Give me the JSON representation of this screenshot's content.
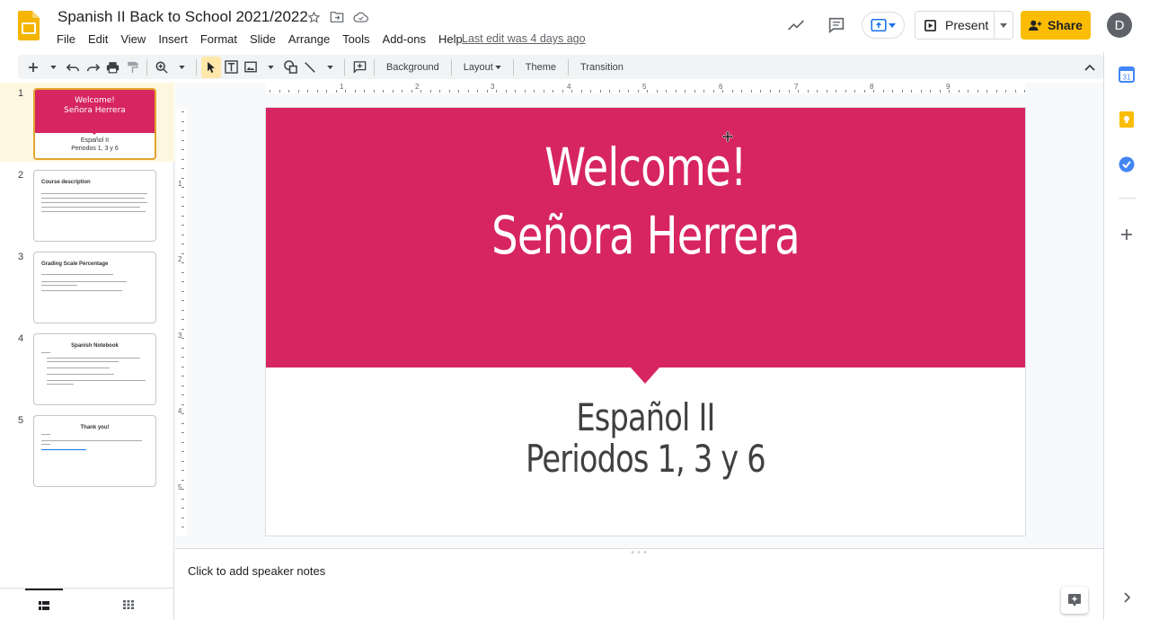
{
  "header": {
    "title": "Spanish II Back to School 2021/2022",
    "last_edit": "Last edit was 4 days ago",
    "menu": [
      "File",
      "Edit",
      "View",
      "Insert",
      "Format",
      "Slide",
      "Arrange",
      "Tools",
      "Add-ons",
      "Help"
    ],
    "present_label": "Present",
    "share_label": "Share",
    "avatar_initial": "D"
  },
  "toolbar": {
    "background_label": "Background",
    "layout_label": "Layout",
    "theme_label": "Theme",
    "transition_label": "Transition"
  },
  "filmstrip": {
    "slides": [
      {
        "num": "1",
        "title_line1": "Welcome!",
        "title_line2": "Señora Herrera",
        "sub_line1": "Español II",
        "sub_line2": "Periodos 1, 3 y 6"
      },
      {
        "num": "2",
        "heading": "Course description"
      },
      {
        "num": "3",
        "heading": "Grading Scale Percentage"
      },
      {
        "num": "4",
        "heading": "Spanish Notebook"
      },
      {
        "num": "5",
        "heading": "Thank you!"
      }
    ]
  },
  "ruler": {
    "h_labels": [
      "1",
      "2",
      "3",
      "4",
      "5",
      "6",
      "7",
      "8",
      "9"
    ],
    "v_labels": [
      "1",
      "2",
      "3",
      "4",
      "5"
    ]
  },
  "slide": {
    "title_line1": "Welcome!",
    "title_line2": "Señora Herrera",
    "sub_line1": "Español II",
    "sub_line2": "Periodos 1, 3 y 6",
    "accent_color": "#d72562"
  },
  "notes": {
    "placeholder": "Click to add speaker notes"
  },
  "side_panel": {
    "calendar_label": "31"
  }
}
